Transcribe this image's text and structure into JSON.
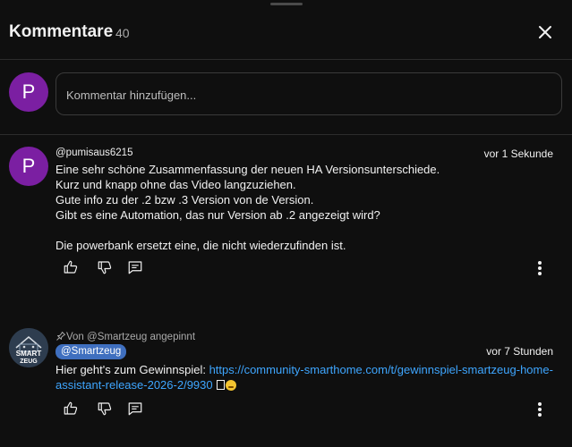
{
  "header": {
    "title": "Kommentare",
    "count": "40"
  },
  "composer": {
    "avatar_letter": "P",
    "placeholder": "Kommentar hinzufügen..."
  },
  "comments": [
    {
      "avatar_letter": "P",
      "author": "@pumisaus6215",
      "time": "vor 1 Sekunde",
      "lines": [
        "Eine sehr schöne Zusammenfassung der neuen HA Versionsunterschiede.",
        "Kurz und knapp ohne das Video langzuziehen.",
        "Gute info zu der .2 bzw .3 Version von de Version.",
        "Gibt es eine Automation, das nur Version ab .2 angezeigt wird?",
        "",
        "Die powerbank ersetzt eine, die nicht wiederzufinden ist."
      ]
    },
    {
      "avatar_label": "SMART ZEUG",
      "pinned_label": "Von @Smartzeug angepinnt",
      "author": "@Smartzeug",
      "time": "vor 7 Stunden",
      "text_prefix": "Hier geht's zum Gewinnspiel: ",
      "link_line1": "https://community-smarthome.com/t/gewinnspiel-smartzeug-home-",
      "link_line2": "assistant-release-2026-2/9930"
    }
  ]
}
